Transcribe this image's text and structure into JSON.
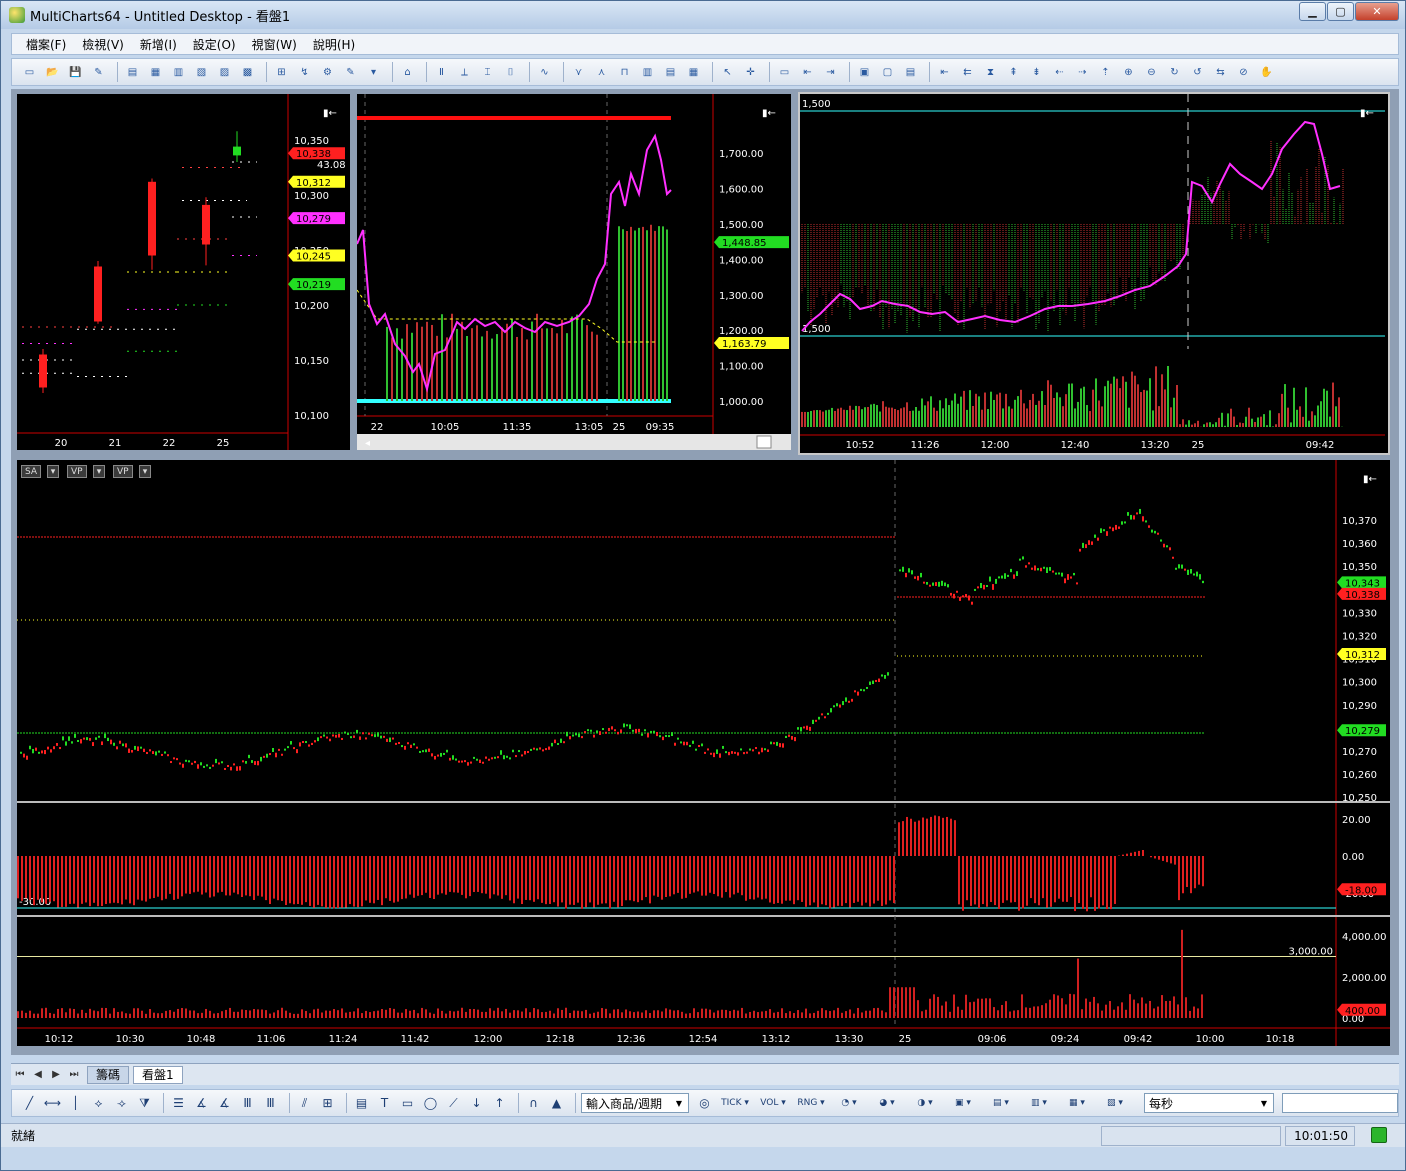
{
  "window": {
    "title": "MultiCharts64 - Untitled Desktop - 看盤1"
  },
  "menu": [
    "檔案(F)",
    "檢視(V)",
    "新增(I)",
    "設定(O)",
    "視窗(W)",
    "說明(H)"
  ],
  "colors": {
    "up": "#ff2020",
    "down": "#22dd22",
    "magenta": "#ff30ff",
    "cyan": "#33ffff",
    "yellow": "#ffff22",
    "axis": "#cc0000"
  },
  "panel1": {
    "y_labels": [
      "10,350",
      "10,300",
      "10,250",
      "10,200",
      "10,150",
      "10,100"
    ],
    "x_labels": [
      "20",
      "21",
      "22",
      "25"
    ],
    "tags": [
      {
        "text": "10,338",
        "color": "#ff2020",
        "fg": "#000"
      },
      {
        "text": "10,312",
        "color": "#ffff22",
        "fg": "#000"
      },
      {
        "text": "10,279",
        "color": "#ff30ff",
        "fg": "#000"
      },
      {
        "text": "10,245",
        "color": "#ffff22",
        "fg": "#000"
      },
      {
        "text": "10,219",
        "color": "#22dd22",
        "fg": "#000"
      }
    ],
    "small_label": "43.08"
  },
  "panel2": {
    "y_labels": [
      "1,700.00",
      "1,600.00",
      "1,500.00",
      "1,400.00",
      "1,300.00",
      "1,200.00",
      "1,100.00",
      "1,000.00"
    ],
    "x_labels": [
      "22",
      "10:05",
      "11:35",
      "13:05",
      "25",
      "09:35"
    ],
    "tags": [
      {
        "text": "1,448.85",
        "color": "#22dd22",
        "fg": "#000"
      },
      {
        "text": "1,163.79",
        "color": "#ffff22",
        "fg": "#000"
      }
    ]
  },
  "panel3": {
    "top_label": "1,500",
    "mid_label": "1,500",
    "x_labels": [
      "10:52",
      "11:26",
      "12:00",
      "12:40",
      "13:20",
      "25",
      "09:42"
    ]
  },
  "main": {
    "buttons": [
      "SA",
      "VP",
      "VP"
    ],
    "price_labels": [
      "10,370",
      "10,360",
      "10,350",
      "10,340",
      "10,330",
      "10,320",
      "10,310",
      "10,300",
      "10,290",
      "10,280",
      "10,270",
      "10,260",
      "10,250"
    ],
    "tags": [
      {
        "text": "10,343",
        "color": "#22dd22",
        "fg": "#000"
      },
      {
        "text": "10,338",
        "color": "#ff2020",
        "fg": "#000"
      },
      {
        "text": "10,312",
        "color": "#ffff22",
        "fg": "#000"
      },
      {
        "text": "10,279",
        "color": "#22dd22",
        "fg": "#000"
      }
    ],
    "osc_labels": [
      "20.00",
      "0.00",
      "-20.00"
    ],
    "osc_left_label": "-30.00",
    "osc_tag": {
      "text": "-18.00",
      "color": "#ff2020",
      "fg": "#000"
    },
    "vol_labels": [
      "4,000.00",
      "2,000.00",
      "0.00"
    ],
    "vol_line_label": "3,000.00",
    "vol_tag": {
      "text": "400.00",
      "color": "#ff2020",
      "fg": "#000"
    },
    "x_labels": [
      "10:12",
      "10:30",
      "10:48",
      "11:06",
      "11:24",
      "11:42",
      "12:00",
      "12:18",
      "12:36",
      "12:54",
      "13:12",
      "13:30",
      "25",
      "09:06",
      "09:24",
      "09:42",
      "10:00",
      "10:18"
    ]
  },
  "sheets": [
    "籌碼",
    "看盤1"
  ],
  "drawbar": {
    "symbol_combo": "輸入商品/週期",
    "interval_combo": "每秒"
  },
  "status": {
    "text": "就緒",
    "time": "10:01:50"
  }
}
